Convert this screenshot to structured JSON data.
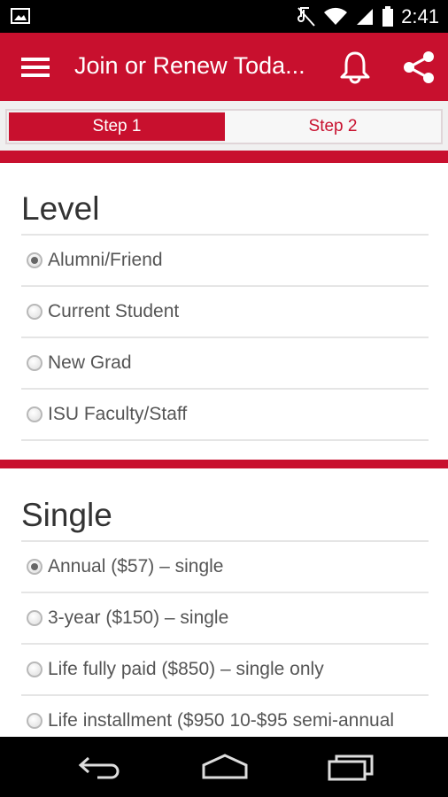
{
  "status_bar": {
    "time": "2:41",
    "icons": [
      "image-icon",
      "mute-icon",
      "wifi-icon",
      "signal-icon",
      "battery-icon"
    ]
  },
  "app_bar": {
    "title": "Join or Renew Toda...",
    "icons": [
      "menu-icon",
      "bell-icon",
      "share-icon"
    ],
    "color": "#c8102e"
  },
  "steps": [
    {
      "label": "Step 1",
      "active": true
    },
    {
      "label": "Step 2",
      "active": false
    }
  ],
  "level": {
    "title": "Level",
    "options": [
      {
        "label": "Alumni/Friend",
        "checked": true
      },
      {
        "label": "Current Student",
        "checked": false
      },
      {
        "label": "New Grad",
        "checked": false
      },
      {
        "label": "ISU Faculty/Staff",
        "checked": false
      }
    ]
  },
  "single": {
    "title": "Single",
    "options": [
      {
        "label": "Annual ($57) – single",
        "checked": true
      },
      {
        "label": "3-year ($150) – single",
        "checked": false
      },
      {
        "label": "Life fully paid ($850) – single only",
        "checked": false
      },
      {
        "label": "Life installment ($950 10-$95 semi-annual",
        "checked": false
      }
    ]
  },
  "nav_bar": {
    "icons": [
      "back-icon",
      "home-icon",
      "recent-apps-icon"
    ]
  }
}
